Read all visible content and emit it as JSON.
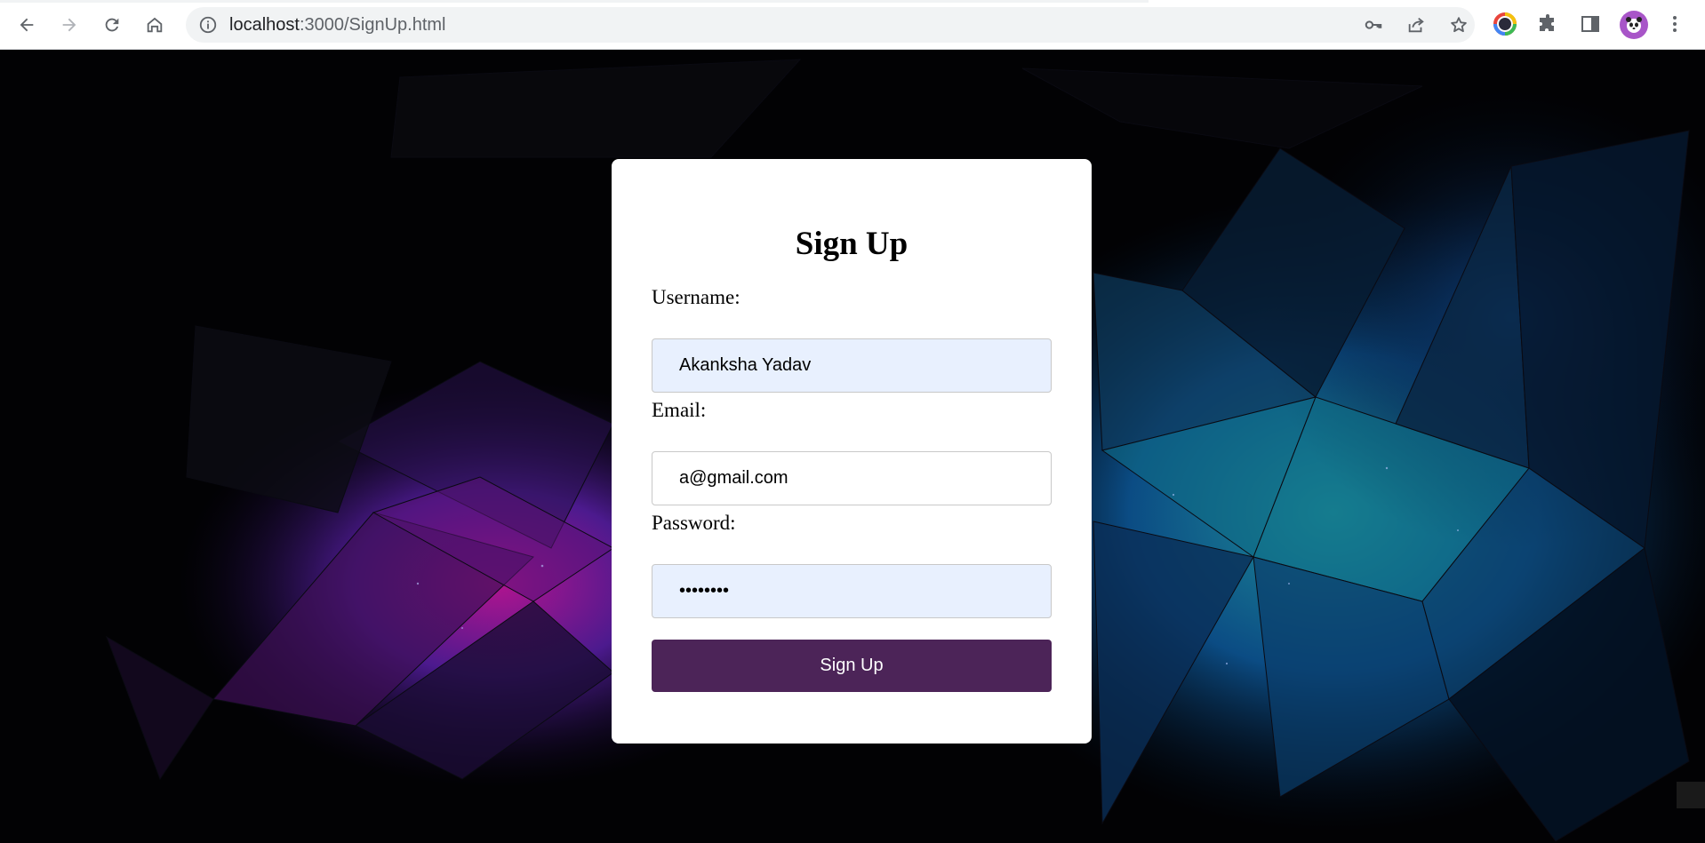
{
  "browser": {
    "url_host": "localhost",
    "url_rest": ":3000/SignUp.html",
    "icons": {
      "back": "back-arrow-icon",
      "forward": "forward-arrow-icon",
      "reload": "reload-icon",
      "home": "home-icon",
      "site_info": "info-icon",
      "password": "key-icon",
      "share": "share-icon",
      "bookmark": "star-icon",
      "extension": "puzzle-icon",
      "side_panel": "side-panel-icon",
      "menu": "kebab-menu-icon"
    }
  },
  "form": {
    "title": "Sign Up",
    "username_label": "Username:",
    "username_value": "Akanksha Yadav",
    "email_label": "Email:",
    "email_value": "a@gmail.com",
    "password_label": "Password:",
    "password_value": "password",
    "submit_label": "Sign Up"
  },
  "colors": {
    "button": "#4c2458",
    "autofill": "#e8f0fe",
    "background": "#020204"
  }
}
